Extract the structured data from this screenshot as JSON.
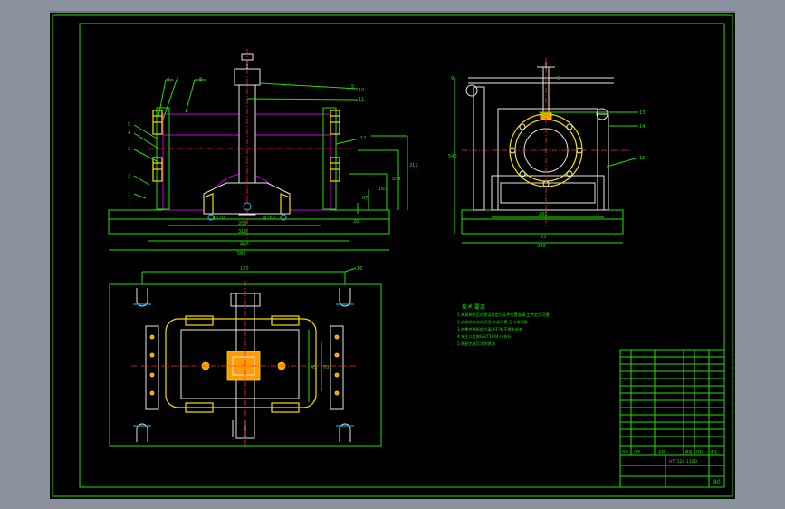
{
  "colors": {
    "background": "#8a939d",
    "sheet": "#000000",
    "line": "#22e000",
    "part": "#e8e8e8",
    "highlight": "#f5e000",
    "hidden": "#c400e0",
    "center": "#ff2a2a"
  },
  "front_view": {
    "balloons": [
      "4",
      "3",
      "8",
      "5",
      "10",
      "11",
      "5",
      "4",
      "3",
      "2",
      "1",
      "12"
    ],
    "dims": {
      "total_width": "560",
      "inner_width": "460",
      "span_1": "200",
      "span_2": "310",
      "bore_1": "φ120",
      "bore_2": "φ160",
      "h_1": "311",
      "h_2": "284",
      "h_3": "160",
      "h_4": "67",
      "h_5": "20"
    }
  },
  "side_view": {
    "balloons": [
      "9",
      "6",
      "13",
      "14",
      "15"
    ],
    "dims": {
      "height": "540",
      "base_width": "390",
      "inner": "23",
      "bore": "260"
    }
  },
  "top_view": {
    "balloons": [
      "16"
    ],
    "dims": {
      "width": "120",
      "h_1": "45",
      "h_2": "70"
    }
  },
  "notes": {
    "title": "技术 要求",
    "lines": [
      "1.夹具装配后应保证各定位元件位置准确,工件定位可靠.",
      "2.夹紧机构动作灵活,夹紧可靠,无卡滞现象.",
      "3.各零件装配前应清洗干净,不得有毛刺.",
      "4.未注公差按GB/T1804-m执行.",
      "5.装配完成后涂防锈油."
    ]
  },
  "title_block": {
    "drawing_no": "HTF220-110D",
    "sheet": "80",
    "header_row": [
      "序号",
      "代号",
      "名称",
      "数量",
      "材料",
      "备注"
    ]
  }
}
